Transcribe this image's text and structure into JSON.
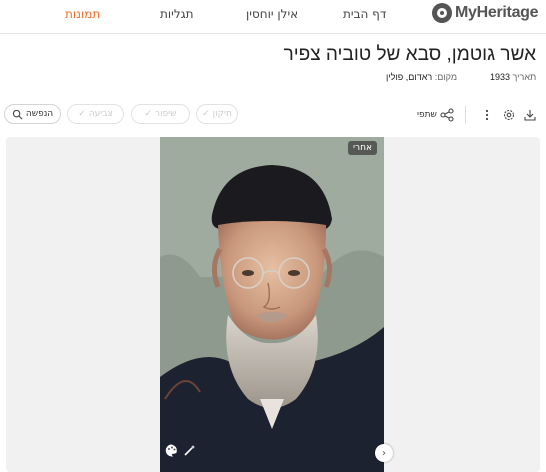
{
  "header": {
    "brand": "MyHeritage",
    "nav": [
      {
        "label": "דף הבית",
        "active": false
      },
      {
        "label": "אילן יוחסין",
        "active": false
      },
      {
        "label": "תגליות",
        "active": false
      },
      {
        "label": "תמונות",
        "active": true
      }
    ],
    "active_color": "#f26b2a"
  },
  "photo_info": {
    "title": "אשר גוטמן, סבא של טוביה צפיר",
    "date_label": "תאריך",
    "date_value": "1933",
    "place_label": "מקום:",
    "place_value": "ראדום, פולין"
  },
  "toolbar": {
    "animate_label": "הנפשה",
    "colorize_label": "צביעה",
    "enhance_label": "שיפור",
    "repair_label": "תיקון",
    "share_label": "שתפי",
    "icons": [
      "animate-icon",
      "check-icon",
      "share-icon",
      "more-icon",
      "settings-icon",
      "download-icon"
    ]
  },
  "viewer": {
    "badge": "אחרי"
  }
}
